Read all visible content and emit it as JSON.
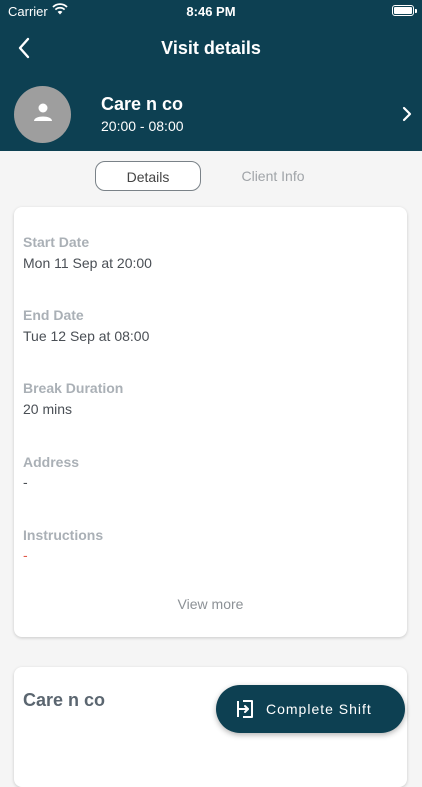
{
  "status_bar": {
    "carrier": "Carrier",
    "time": "8:46 PM"
  },
  "nav": {
    "title": "Visit details"
  },
  "client": {
    "name": "Care n co",
    "time_range": "20:00 - 08:00"
  },
  "tabs": [
    {
      "label": "Details",
      "active": true
    },
    {
      "label": "Client Info",
      "active": false
    }
  ],
  "details": {
    "start_label": "Start Date",
    "start_value": "Mon 11 Sep at 20:00",
    "end_label": "End Date",
    "end_value": "Tue 12 Sep at 08:00",
    "break_label": "Break Duration",
    "break_value": "20 mins",
    "address_label": "Address",
    "address_value": "-",
    "instructions_label": "Instructions",
    "instructions_value": "-",
    "view_more": "View more"
  },
  "client_card": {
    "title": "Care n co"
  },
  "fab": {
    "label": "Complete Shift"
  },
  "colors": {
    "primary": "#0d4052",
    "muted_label": "#aab0b6",
    "alert": "#e05a4a"
  },
  "icons": [
    "wifi-icon",
    "battery-icon",
    "back-arrow-icon",
    "person-icon",
    "chevron-right-icon",
    "exit-icon"
  ]
}
